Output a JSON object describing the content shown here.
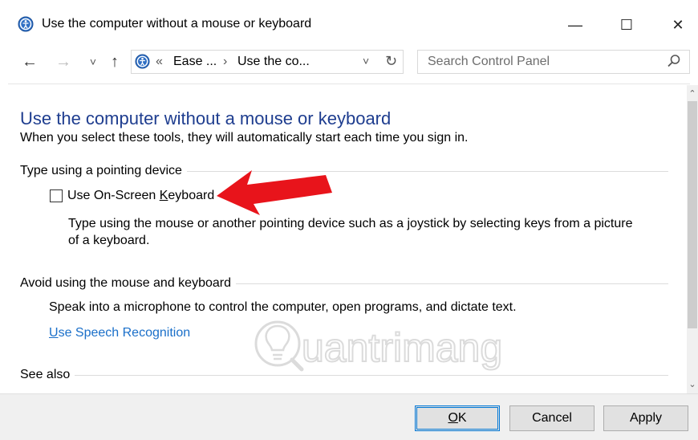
{
  "window": {
    "title": "Use the computer without a mouse or keyboard",
    "minimize": "—",
    "maximize": "☐",
    "close": "✕"
  },
  "nav": {
    "back": "←",
    "forward": "→",
    "recent": "˅",
    "up": "↑",
    "crumb_prefix": "«",
    "crumb1": "Ease ...",
    "sep": "›",
    "crumb2": "Use the co...",
    "dropdown": "˅",
    "refresh": "↻"
  },
  "search": {
    "placeholder": "Search Control Panel"
  },
  "main": {
    "heading": "Use the computer without a mouse or keyboard",
    "subtext": "When you select these tools, they will automatically start each time you sign in.",
    "section1": {
      "title": "Type using a pointing device",
      "checkbox_label_pre": "Use On-Screen ",
      "checkbox_label_access": "K",
      "checkbox_label_post": "eyboard",
      "checked": false,
      "desc_line1": "Type using the mouse or another pointing device such as a joystick by selecting keys from a picture",
      "desc_line2": "of a keyboard."
    },
    "section2": {
      "title": "Avoid using the mouse and keyboard",
      "desc": "Speak into a microphone to control the computer, open programs, and dictate text.",
      "link_access": "U",
      "link_rest": "se Speech Recognition"
    },
    "section3": {
      "title": "See also"
    }
  },
  "scroll": {
    "up": "⌃",
    "down": "⌄"
  },
  "buttons": {
    "ok_access": "O",
    "ok_rest": "K",
    "cancel": "Cancel",
    "apply": "Apply"
  },
  "watermark": {
    "text": "uantrimang"
  },
  "colors": {
    "heading": "#1e3d8f",
    "link": "#1a6fc9",
    "arrow": "#e8141b"
  }
}
